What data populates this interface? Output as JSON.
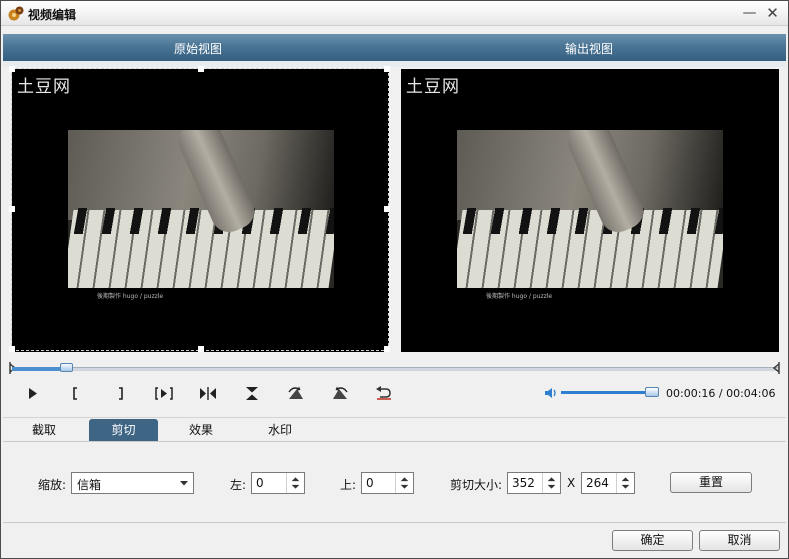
{
  "window": {
    "title": "视频编辑",
    "minimize_glyph": "—",
    "close_glyph": "✕"
  },
  "view_header": {
    "original_label": "原始视图",
    "output_label": "输出视图"
  },
  "preview": {
    "watermark": "土豆网",
    "credit": "後期製作 hugo / puzzle"
  },
  "playback": {
    "position_fraction": 0.07,
    "volume_fraction": 0.92,
    "time": "00:00:16 / 00:04:06",
    "icons": [
      "play-icon",
      "mark-in-icon",
      "mark-out-icon",
      "play-selection-icon",
      "split-icon",
      "flip-vertical-icon",
      "rotate-left-icon",
      "rotate-right-icon",
      "undo-icon"
    ]
  },
  "tabs": [
    {
      "label": "截取",
      "active": false
    },
    {
      "label": "剪切",
      "active": true
    },
    {
      "label": "效果",
      "active": false
    },
    {
      "label": "水印",
      "active": false
    }
  ],
  "crop": {
    "zoom_label": "缩放:",
    "zoom_value": "信箱",
    "left_label": "左:",
    "left_value": "0",
    "top_label": "上:",
    "top_value": "0",
    "size_label": "剪切大小:",
    "width_value": "352",
    "times_label": "X",
    "height_value": "264",
    "reset_label": "重置"
  },
  "footer": {
    "ok_label": "确定",
    "cancel_label": "取消"
  },
  "colors": {
    "header_blue": "#4b7595",
    "active_tab": "#3f6584",
    "slider_blue": "#2f7fd0"
  }
}
